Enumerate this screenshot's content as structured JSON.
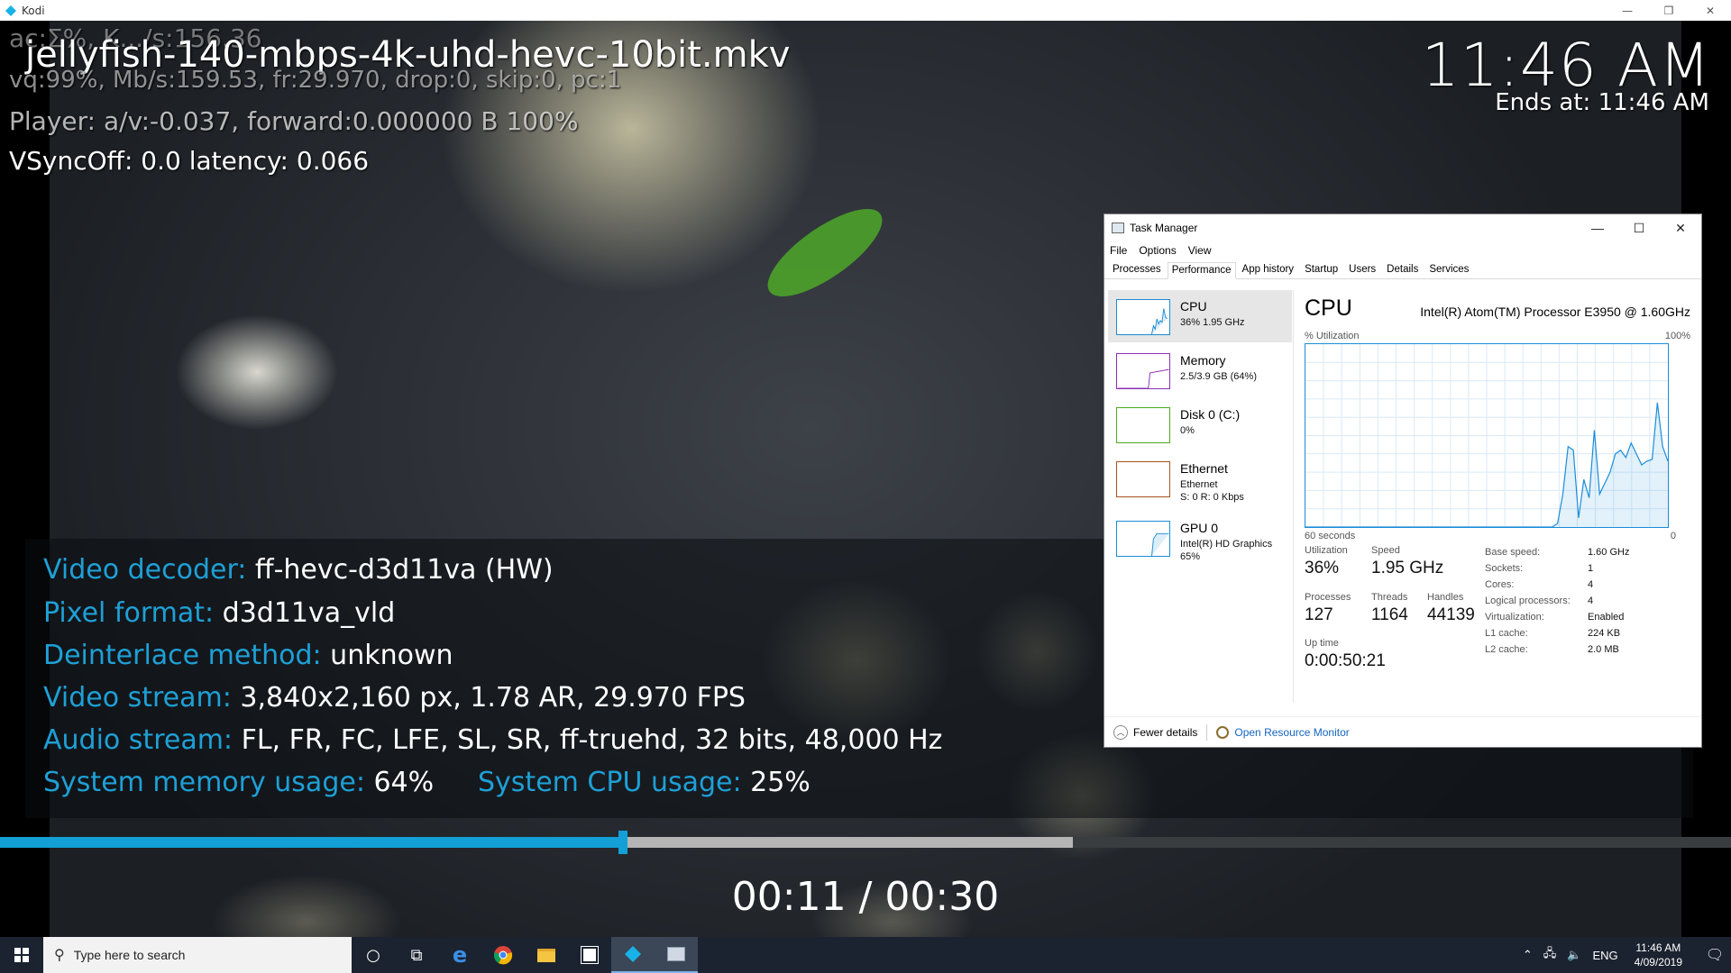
{
  "kodi_window": {
    "title": "Kodi"
  },
  "osd": {
    "filename": "jellyfish-140-mbps-4k-uhd-hevc-10bit.mkv",
    "clock": "11:46 AM",
    "ends_at": "Ends at: 11:46 AM",
    "debug_line0": "ac:Ʃ%, K.../s:156.36",
    "debug_line1": "vq:99%, Mb/s:159.53, fr:29.970, drop:0, skip:0, pc:1",
    "debug_line2": "Player: a/v:-0.037,  forward:0.000000 B 100%",
    "debug_line3": "VSyncOff: 0.0 latency: 0.066",
    "time": "00:11 / 00:30",
    "progress_played": 0.36,
    "progress_cached": 0.62
  },
  "codec_info": {
    "decoder_label": "Video decoder:",
    "decoder_value": " ff-hevc-d3d11va (HW)",
    "pixel_label": "Pixel format:",
    "pixel_value": " d3d11va_vld",
    "deint_label": "Deinterlace method:",
    "deint_value": " unknown",
    "vstream_label": "Video stream:",
    "vstream_value": " 3,840x2,160 px, 1.78 AR, 29.970 FPS",
    "astream_label": "Audio stream:",
    "astream_value": " FL, FR, FC, LFE, SL, SR, ff-truehd, 32 bits, 48,000 Hz",
    "mem_label": "System memory usage:",
    "mem_value": " 64%",
    "cpu_label": "System CPU usage:",
    "cpu_value": " 25%"
  },
  "task_manager": {
    "title": "Task Manager",
    "menu": [
      "File",
      "Options",
      "View"
    ],
    "tabs": [
      "Processes",
      "Performance",
      "App history",
      "Startup",
      "Users",
      "Details",
      "Services"
    ],
    "active_tab": "Performance",
    "resources": [
      {
        "name": "CPU",
        "sub1": "36%  1.95 GHz",
        "sub2": "",
        "color": "#1a8cd8"
      },
      {
        "name": "Memory",
        "sub1": "2.5/3.9 GB (64%)",
        "sub2": "",
        "color": "#8b2fb6"
      },
      {
        "name": "Disk 0 (C:)",
        "sub1": "0%",
        "sub2": "",
        "color": "#4da81c"
      },
      {
        "name": "Ethernet",
        "sub1": "Ethernet",
        "sub2": "S: 0 R: 0 Kbps",
        "color": "#a7541b"
      },
      {
        "name": "GPU 0",
        "sub1": "Intel(R) HD Graphics",
        "sub2": "65%",
        "color": "#1a8cd8"
      }
    ],
    "cpu_title": "CPU",
    "cpu_name": "Intel(R) Atom(TM) Processor E3950 @ 1.60GHz",
    "util_label": "% Utilization",
    "util_max": "100%",
    "graph_left": "60 seconds",
    "graph_right": "0",
    "cpu_history": [
      0,
      0,
      0,
      0,
      0,
      0,
      0,
      0,
      0,
      0,
      0,
      0,
      0,
      0,
      0,
      0,
      0,
      0,
      0,
      0,
      0,
      0,
      0,
      0,
      0,
      0,
      0,
      0,
      0,
      0,
      0,
      0,
      0,
      0,
      0,
      0,
      0,
      0,
      0,
      0,
      0,
      0,
      0,
      0,
      0,
      0,
      0,
      0,
      2,
      18,
      44,
      42,
      5,
      26,
      16,
      53,
      18,
      24,
      30,
      40,
      42,
      38,
      46,
      40,
      34,
      36,
      37,
      68,
      44,
      36
    ],
    "stats": {
      "utilization_label": "Utilization",
      "utilization": "36%",
      "speed_label": "Speed",
      "speed": "1.95 GHz",
      "processes_label": "Processes",
      "processes": "127",
      "threads_label": "Threads",
      "threads": "1164",
      "handles_label": "Handles",
      "handles": "44139",
      "uptime_label": "Up time",
      "uptime": "0:00:50:21"
    },
    "details": [
      {
        "k": "Base speed:",
        "v": "1.60 GHz"
      },
      {
        "k": "Sockets:",
        "v": "1"
      },
      {
        "k": "Cores:",
        "v": "4"
      },
      {
        "k": "Logical processors:",
        "v": "4"
      },
      {
        "k": "Virtualization:",
        "v": "Enabled"
      },
      {
        "k": "L1 cache:",
        "v": "224 KB"
      },
      {
        "k": "L2 cache:",
        "v": "2.0 MB"
      }
    ],
    "fewer_details": "Fewer details",
    "open_resmon": "Open Resource Monitor"
  },
  "taskbar": {
    "search_placeholder": "Type here to search",
    "lang": "ENG",
    "time": "11:46 AM",
    "date": "4/09/2019"
  }
}
